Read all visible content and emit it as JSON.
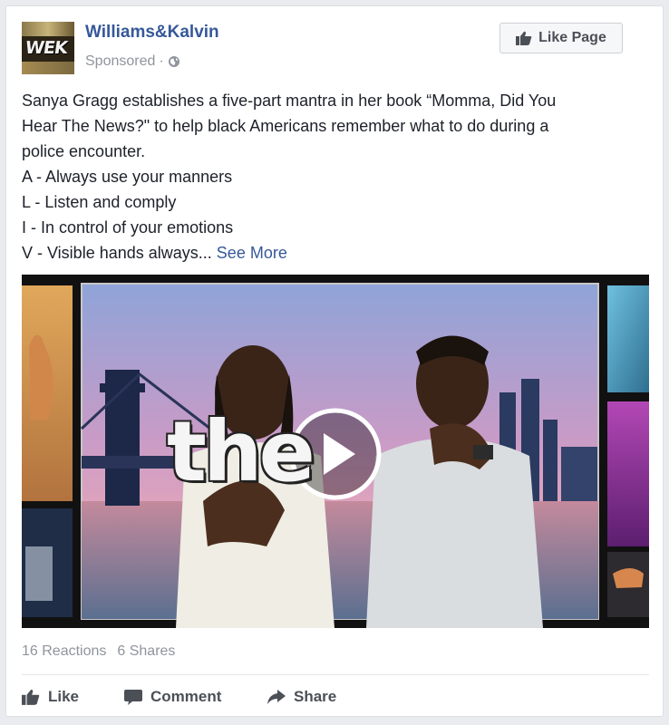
{
  "header": {
    "avatar_text": "WEK",
    "page_name": "Williams&Kalvin",
    "sponsored": "Sponsored",
    "separator": "·",
    "like_page_label": "Like Page"
  },
  "post": {
    "lines": [
      "Sanya Gragg establishes a five-part mantra in her book “Momma, Did You",
      "Hear The News?\" to help black Americans remember what to do during a",
      "police encounter.",
      "A - Always use your manners",
      "L - Listen and comply",
      "I - In control of your emotions",
      "V - Visible hands always..."
    ],
    "see_more": "See More"
  },
  "video": {
    "overlay_text": "the"
  },
  "stats": {
    "reactions": "16 Reactions",
    "shares": "6 Shares"
  },
  "actions": {
    "like": "Like",
    "comment": "Comment",
    "share": "Share"
  },
  "colors": {
    "link": "#365899",
    "muted": "#90949c",
    "text": "#1d2129",
    "action": "#4b4f56"
  }
}
